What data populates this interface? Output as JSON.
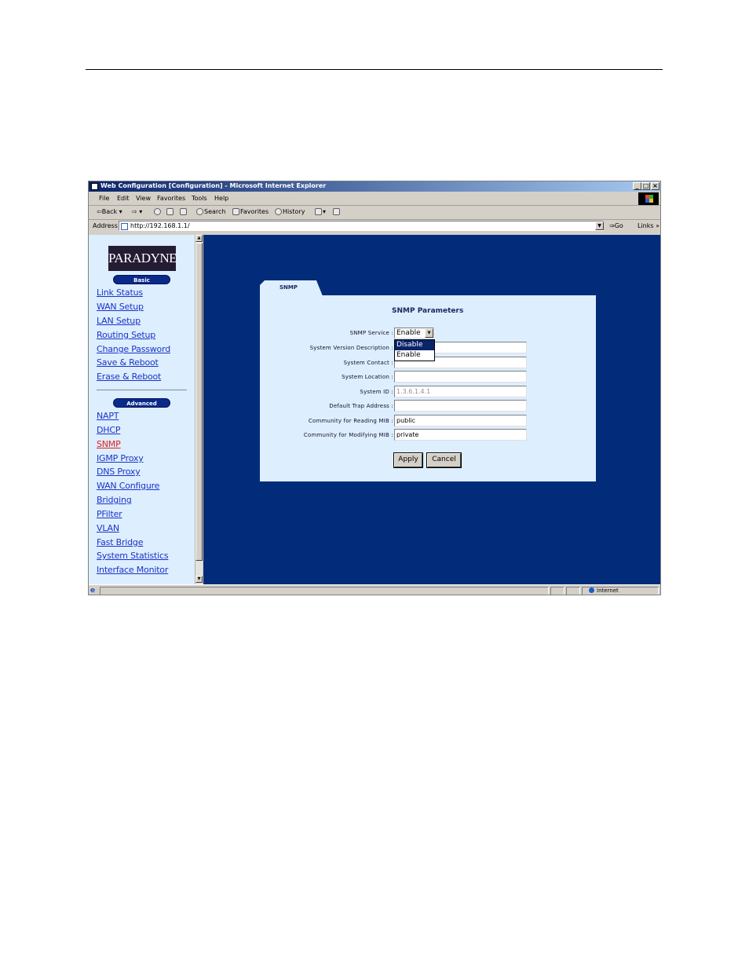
{
  "window": {
    "title": "Web Configuration [Configuration] - Microsoft Internet Explorer",
    "controls": {
      "minimize": "_",
      "maximize": "□",
      "close": "×"
    }
  },
  "menubar": {
    "items": [
      "File",
      "Edit",
      "View",
      "Favorites",
      "Tools",
      "Help"
    ]
  },
  "toolbar": {
    "back": "⇦Back",
    "forward": "⇨",
    "search": "Search",
    "favorites": "Favorites",
    "history": "History"
  },
  "address": {
    "label": "Address",
    "url": "http://192.168.1.1/",
    "go": "⇒Go",
    "links": "Links »"
  },
  "sidebar": {
    "logo": "PARADYNE",
    "basic_label": "Basic",
    "basic_links": [
      "Link Status",
      "WAN Setup",
      "LAN Setup",
      "Routing Setup",
      "Change Password",
      "Save & Reboot",
      "Erase & Reboot"
    ],
    "advanced_label": "Advanced",
    "advanced_links": [
      "NAPT",
      "DHCP",
      "SNMP",
      "IGMP Proxy",
      "DNS Proxy",
      "WAN Configure",
      "Bridging",
      "PFilter",
      "VLAN",
      "Fast Bridge",
      "System Statistics",
      "Interface Monitor"
    ],
    "active_link": "SNMP"
  },
  "content": {
    "tab_label": "SNMP",
    "panel_title": "SNMP Parameters",
    "fields": {
      "snmp_service": {
        "label": "SNMP Service :",
        "value": "Enable",
        "options": [
          "Disable",
          "Enable"
        ],
        "highlighted": "Disable"
      },
      "system_version_description": {
        "label": "System Version Description :",
        "value": ""
      },
      "system_contact": {
        "label": "System Contact :",
        "value": ""
      },
      "system_location": {
        "label": "System Location :",
        "value": ""
      },
      "system_id": {
        "label": "System ID :",
        "value": "1.3.6.1.4.1"
      },
      "default_trap_address": {
        "label": "Default Trap Address :",
        "value": ""
      },
      "community_reading": {
        "label": "Community for Reading MIB :",
        "value": "public"
      },
      "community_modifying": {
        "label": "Community for Modifying MIB :",
        "value": "private"
      }
    },
    "apply_label": "Apply",
    "cancel_label": "Cancel"
  },
  "statusbar": {
    "zone": "Internet"
  },
  "colors": {
    "content_bg": "#022c7a",
    "panel_bg": "#ddeeff",
    "link": "#1a34c8",
    "active_link": "#e02020"
  }
}
